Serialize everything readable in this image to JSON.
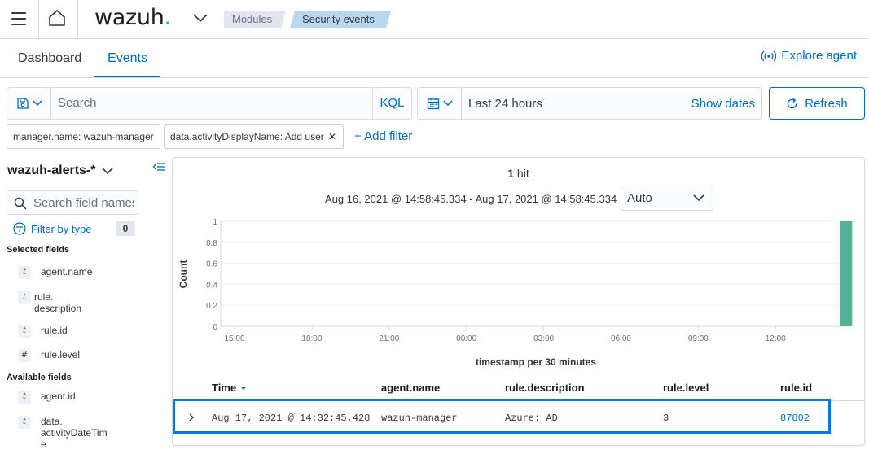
{
  "header": {
    "logo_text": "wazuh",
    "logo_dot": ".",
    "breadcrumbs": [
      "Modules",
      "Security events"
    ]
  },
  "tabs": [
    {
      "label": "Dashboard",
      "active": false
    },
    {
      "label": "Events",
      "active": true
    }
  ],
  "explore_agent": "Explore agent",
  "search": {
    "placeholder": "Search",
    "language": "KQL"
  },
  "date_picker": {
    "value": "Last 24 hours",
    "show_dates": "Show dates"
  },
  "refresh_label": "Refresh",
  "filters": [
    {
      "label": "manager.name: wazuh-manager"
    },
    {
      "label": "data.activityDisplayName: Add user"
    }
  ],
  "add_filter": "+ Add filter",
  "sidebar": {
    "index_pattern": "wazuh-alerts-*",
    "field_search_placeholder": "Search field names",
    "filter_by_type": "Filter by type",
    "filter_count": "0",
    "selected_title": "Selected fields",
    "selected_fields": [
      {
        "type": "t",
        "name": "agent.name"
      },
      {
        "type": "t",
        "name": "rule.\ndescription"
      },
      {
        "type": "t",
        "name": "rule.id"
      },
      {
        "type": "#",
        "name": "rule.level"
      }
    ],
    "available_title": "Available fields",
    "available_fields": [
      {
        "type": "t",
        "name": "agent.id"
      },
      {
        "type": "t",
        "name": "data.\nactivityDateTim\ne"
      }
    ]
  },
  "results": {
    "hit_count": "1",
    "hit_label": " hit",
    "time_range": "Aug 16, 2021 @ 14:58:45.334 - Aug 17, 2021 @ 14:58:45.334",
    "interval": "Auto"
  },
  "chart_data": {
    "type": "bar",
    "ylabel": "Count",
    "xlabel": "timestamp per 30 minutes",
    "ylim": [
      0,
      1
    ],
    "y_ticks": [
      "0",
      "0.2",
      "0.4",
      "0.6",
      "0.8",
      "1"
    ],
    "x_ticks": [
      "15:00",
      "18:00",
      "21:00",
      "00:00",
      "03:00",
      "06:00",
      "09:00",
      "12:00"
    ],
    "x_start_hour": 15,
    "bars": [
      {
        "x": "14:30",
        "value": 1
      }
    ],
    "color": "#54b399"
  },
  "table": {
    "columns": [
      "Time",
      "agent.name",
      "rule.description",
      "rule.level",
      "rule.id"
    ],
    "rows": [
      {
        "time": "Aug 17, 2021 @ 14:32:45.428",
        "agent": "wazuh-manager",
        "description": "Azure: AD",
        "level": "3",
        "id": "87802"
      }
    ]
  }
}
